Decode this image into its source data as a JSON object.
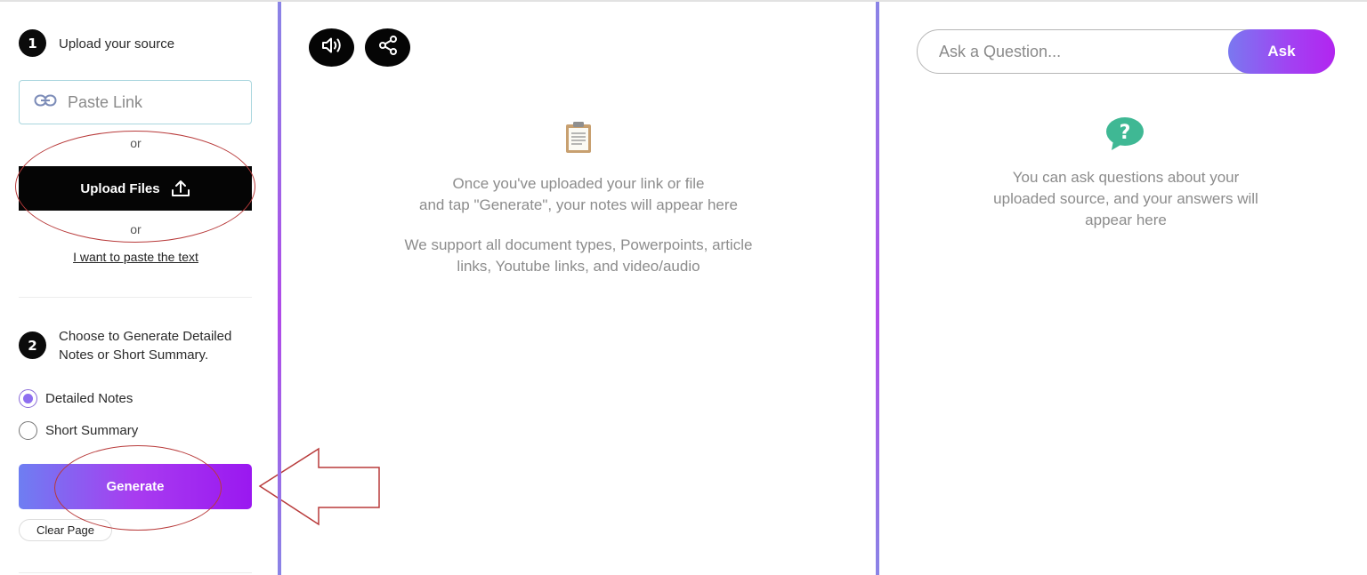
{
  "step1": {
    "number": "1",
    "title": "Upload your source"
  },
  "paste_link": {
    "label": "Paste Link"
  },
  "or_label": "or",
  "upload_files": {
    "label": "Upload Files"
  },
  "paste_text_link": "I want to paste the text",
  "step2": {
    "number": "2",
    "title_line1": "Choose to Generate Detailed",
    "title_line2": "Notes or Short Summary."
  },
  "options": [
    {
      "label": "Detailed Notes",
      "checked": true
    },
    {
      "label": "Short Summary",
      "checked": false
    }
  ],
  "generate": {
    "label": "Generate"
  },
  "clear_page": {
    "label": "Clear Page"
  },
  "toolbar": {
    "icons": [
      "speaker-icon",
      "share-icon"
    ]
  },
  "notes_placeholder": {
    "icon": "clipboard-icon",
    "line1": "Once you've uploaded your link or file",
    "line2": "and tap \"Generate\", your notes will appear here",
    "line3": "We support all document types, Powerpoints, article",
    "line4": "links, Youtube links, and video/audio"
  },
  "ask": {
    "placeholder": "Ask a Question...",
    "button": "Ask"
  },
  "answers_placeholder": {
    "icon": "question-bubble-icon",
    "line1": "You can ask questions about your",
    "line2": "uploaded source, and your answers will",
    "line3": "appear here"
  },
  "colors": {
    "accent_start": "#6e7ef2",
    "accent_end": "#9a18f0",
    "annotation": "#b83a3a",
    "icon_green": "#3fb894"
  }
}
